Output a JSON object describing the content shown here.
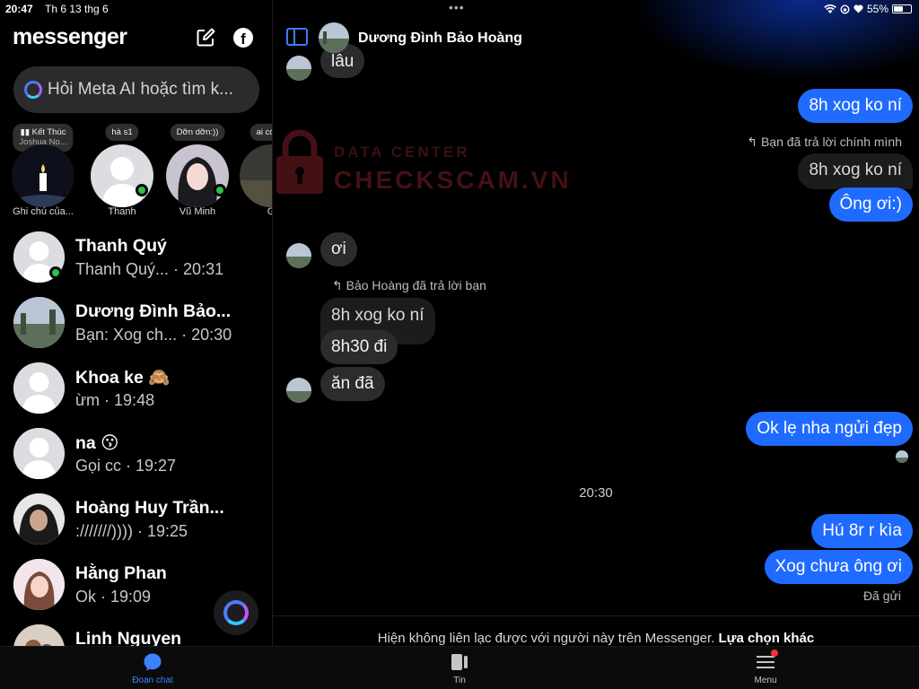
{
  "status_bar": {
    "time": "20:47",
    "date": "Th 6 13 thg 6",
    "battery": "55%",
    "battery_level": 0.55,
    "dots": "•••"
  },
  "sidebar": {
    "title": "messenger",
    "search_placeholder": "Hỏi Meta AI hoặc tìm k...",
    "notes": [
      {
        "bubble_line1": "Kết Thúc",
        "bubble_line2": "Joshua No...",
        "name": "Ghi chú của..."
      },
      {
        "bubble_line1": "hà s1",
        "bubble_line2": "",
        "name": "Thanh"
      },
      {
        "bubble_line1": "Dỡn dỡn:))",
        "bubble_line2": "",
        "name": "Vũ Minh"
      },
      {
        "bubble_line1": "ai có xe",
        "bubble_line2": "",
        "name": "G"
      }
    ],
    "chats": [
      {
        "name": "Thanh Quý",
        "preview": "Thanh Quý... · 20:31"
      },
      {
        "name": "Dương Đình Bảo...",
        "preview": "Bạn: Xog ch... · 20:30"
      },
      {
        "name": "Khoa ke 🙈",
        "preview": "ừm · 19:48"
      },
      {
        "name": "na 😗",
        "preview": "Gọi cc · 19:27"
      },
      {
        "name": "Hoàng Huy Trần...",
        "preview": ":///////)))) · 19:25"
      },
      {
        "name": "Hằng Phan",
        "preview": "Ok · 19:09"
      },
      {
        "name": "Linh Nguyen",
        "preview": ""
      }
    ]
  },
  "conversation": {
    "contact_name": "Dương Đình Bảo Hoàng",
    "top_partial": "lâu",
    "msg_out_1": "8h xog ko ní",
    "reply_label_self": "Bạn đã trả lời chính mình",
    "quoted_self": "8h xog ko ní",
    "msg_out_2": "Ông ơi:)",
    "msg_in_1": "ơi",
    "reply_label_other": "Bảo Hoàng đã trả lời bạn",
    "quoted_other": "8h xog ko ní",
    "msg_in_2": "8h30 đi",
    "msg_in_3": "ăn đã",
    "msg_out_3": "Ok lẹ nha ngửi đẹp",
    "time_separator": "20:30",
    "msg_out_4": "Hú 8r r kìa",
    "msg_out_5": "Xog chưa ông ơi",
    "sent_status": "Đã gửi",
    "footer_text": "Hiện không liên lạc được với người này trên Messenger. ",
    "footer_link": "Lựa chọn khác"
  },
  "watermark": {
    "line1": "DATA CENTER",
    "line2": "CHECKSCAM.VN"
  },
  "tabs": [
    {
      "label": "Đoạn chat",
      "icon": "chat-bubble-icon"
    },
    {
      "label": "Tin",
      "icon": "stories-icon"
    },
    {
      "label": "Menu",
      "icon": "hamburger-icon"
    }
  ],
  "colors": {
    "accent": "#1f6bff",
    "online": "#2bc24b",
    "badge": "#ff2d3d"
  }
}
